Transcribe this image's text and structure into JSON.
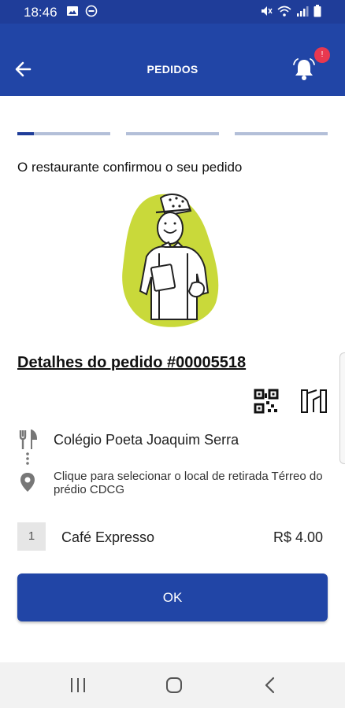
{
  "status_bar": {
    "time": "18:46",
    "left_icons": [
      "image-icon",
      "do-not-disturb-icon"
    ],
    "right_icons": [
      "mute-icon",
      "wifi-icon",
      "signal-icon",
      "battery-icon"
    ]
  },
  "header": {
    "title": "PEDIDOS",
    "back_icon": "arrow-left-icon",
    "bell_icon": "bell-icon",
    "badge": "!"
  },
  "progress": {
    "steps": [
      {
        "fill": 0.18
      },
      {
        "fill": 0
      },
      {
        "fill": 0
      }
    ]
  },
  "order": {
    "status_message": "O restaurante confirmou o seu pedido",
    "title": "Detalhes do pedido #00005518",
    "restaurant": "Colégio Poeta Joaquim Serra",
    "pickup": "Clique para selecionar o local de retirada Térreo do prédio CDCG",
    "items": [
      {
        "quantity": "1",
        "name": "Café Expresso",
        "price": "R$ 4.00"
      }
    ]
  },
  "actions": {
    "ok_label": "OK"
  },
  "colors": {
    "primary": "#2145a6",
    "status_bar": "#1f3d99",
    "badge": "#e8384f",
    "illustration_blob": "#c9d93a"
  }
}
